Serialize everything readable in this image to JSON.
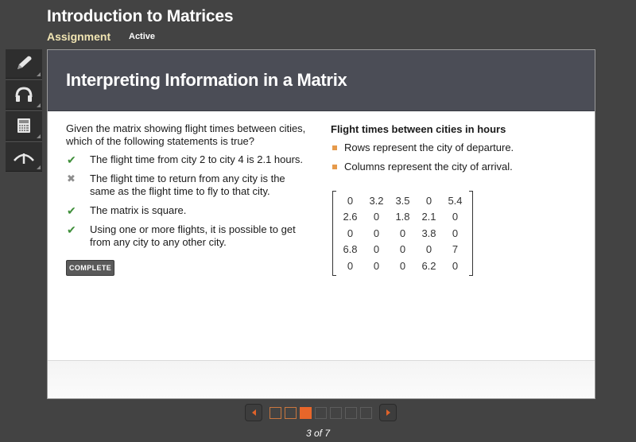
{
  "header": {
    "title": "Introduction to Matrices",
    "type": "Assignment",
    "status": "Active"
  },
  "toolbar": {
    "tools": [
      {
        "name": "pencil-icon",
        "label": "Notes"
      },
      {
        "name": "headphones-icon",
        "label": "Audio"
      },
      {
        "name": "calculator-icon",
        "label": "Calculator"
      },
      {
        "name": "ascent-icon",
        "label": "Exponent"
      }
    ]
  },
  "card": {
    "title": "Interpreting Information in a Matrix",
    "question": "Given the matrix showing flight times between cities, which of the following statements is true?",
    "answers": [
      {
        "text": "The flight time from city 2 to city 4 is 2.1 hours.",
        "status": "correct",
        "mark": "✔"
      },
      {
        "text": "The flight time to return from any city is the same as the flight time to fly to that city.",
        "status": "wrong",
        "mark": "✖"
      },
      {
        "text": "The matrix is square.",
        "status": "correct",
        "mark": "✔"
      },
      {
        "text": "Using one or more flights, it is possible to get from any city to any other city.",
        "status": "correct",
        "mark": "✔"
      }
    ],
    "badge": "COMPLETE",
    "info": {
      "title": "Flight times between cities in hours",
      "bullets": [
        "Rows represent the city of departure.",
        "Columns represent the city of arrival."
      ],
      "matrix": [
        [
          "0",
          "3.2",
          "3.5",
          "0",
          "5.4"
        ],
        [
          "2.6",
          "0",
          "1.8",
          "2.1",
          "0"
        ],
        [
          "0",
          "0",
          "0",
          "3.8",
          "0"
        ],
        [
          "6.8",
          "0",
          "0",
          "0",
          "7"
        ],
        [
          "0",
          "0",
          "0",
          "6.2",
          "0"
        ]
      ]
    }
  },
  "pager": {
    "current": 3,
    "total": 7,
    "label": "3 of 7",
    "pages": [
      "visited",
      "visited",
      "current",
      "unvisited",
      "unvisited",
      "unvisited",
      "unvisited"
    ]
  },
  "colors": {
    "accent": "#e8662a",
    "correct": "#3f8f3a",
    "bullet": "#e69a4b",
    "header_bg": "#4b4d56"
  }
}
